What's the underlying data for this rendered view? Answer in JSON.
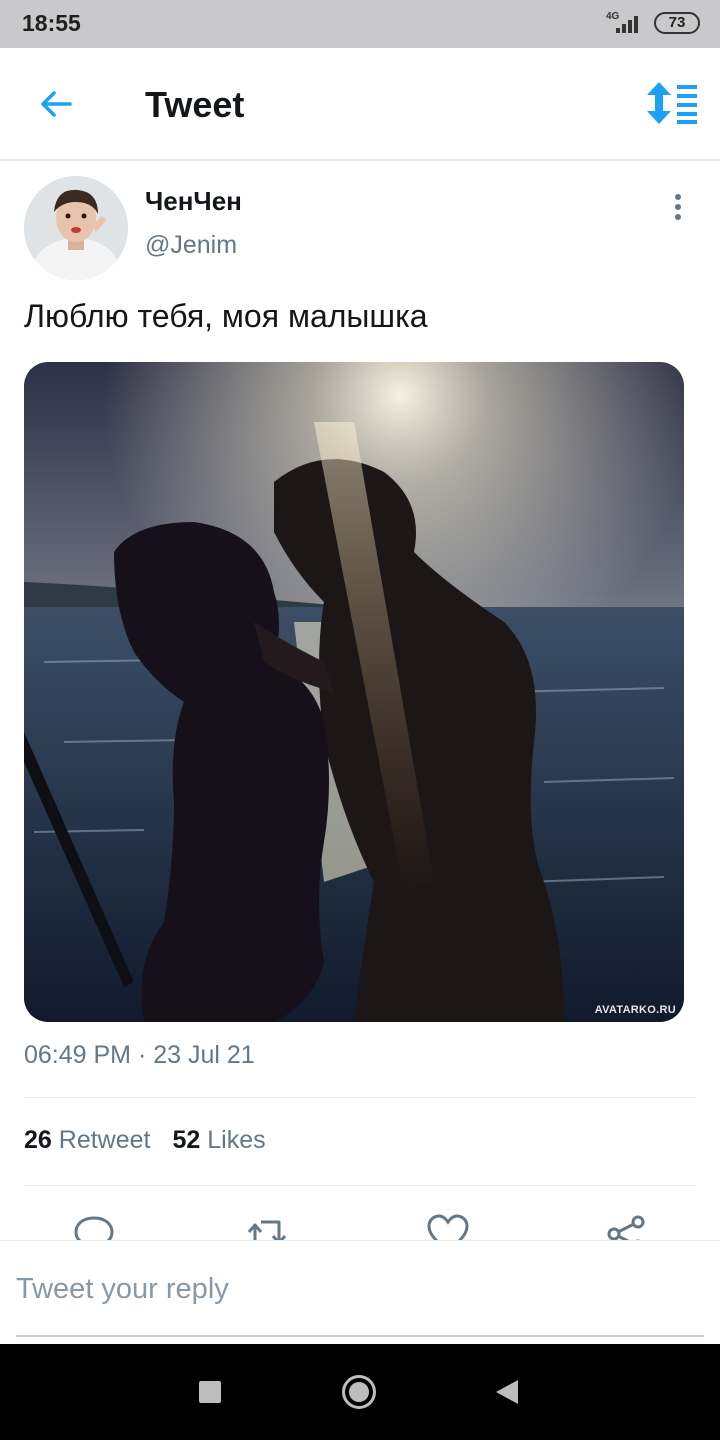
{
  "status_bar": {
    "time": "18:55",
    "network": "4G",
    "battery": "73"
  },
  "header": {
    "title": "Tweet",
    "back_icon": "arrow-left-icon",
    "sort_icon": "sort-toggle-icon"
  },
  "tweet": {
    "author_name": "ЧенЧен",
    "author_handle": "@Jenim",
    "text": "Люблю тебя, моя малышка",
    "media_watermark": "AVATARKO.RU",
    "timestamp": "06:49 PM · 23 Jul 21",
    "retweet_count": "26",
    "retweet_label": "Retweet",
    "like_count": "52",
    "like_label": "Likes"
  },
  "actions": [
    "reply-icon",
    "retweet-icon",
    "like-icon",
    "share-icon"
  ],
  "reply": {
    "placeholder": "Tweet your reply"
  },
  "colors": {
    "accent": "#1da1f2",
    "secondary_text": "#657786",
    "divider": "#e1e8ed"
  }
}
